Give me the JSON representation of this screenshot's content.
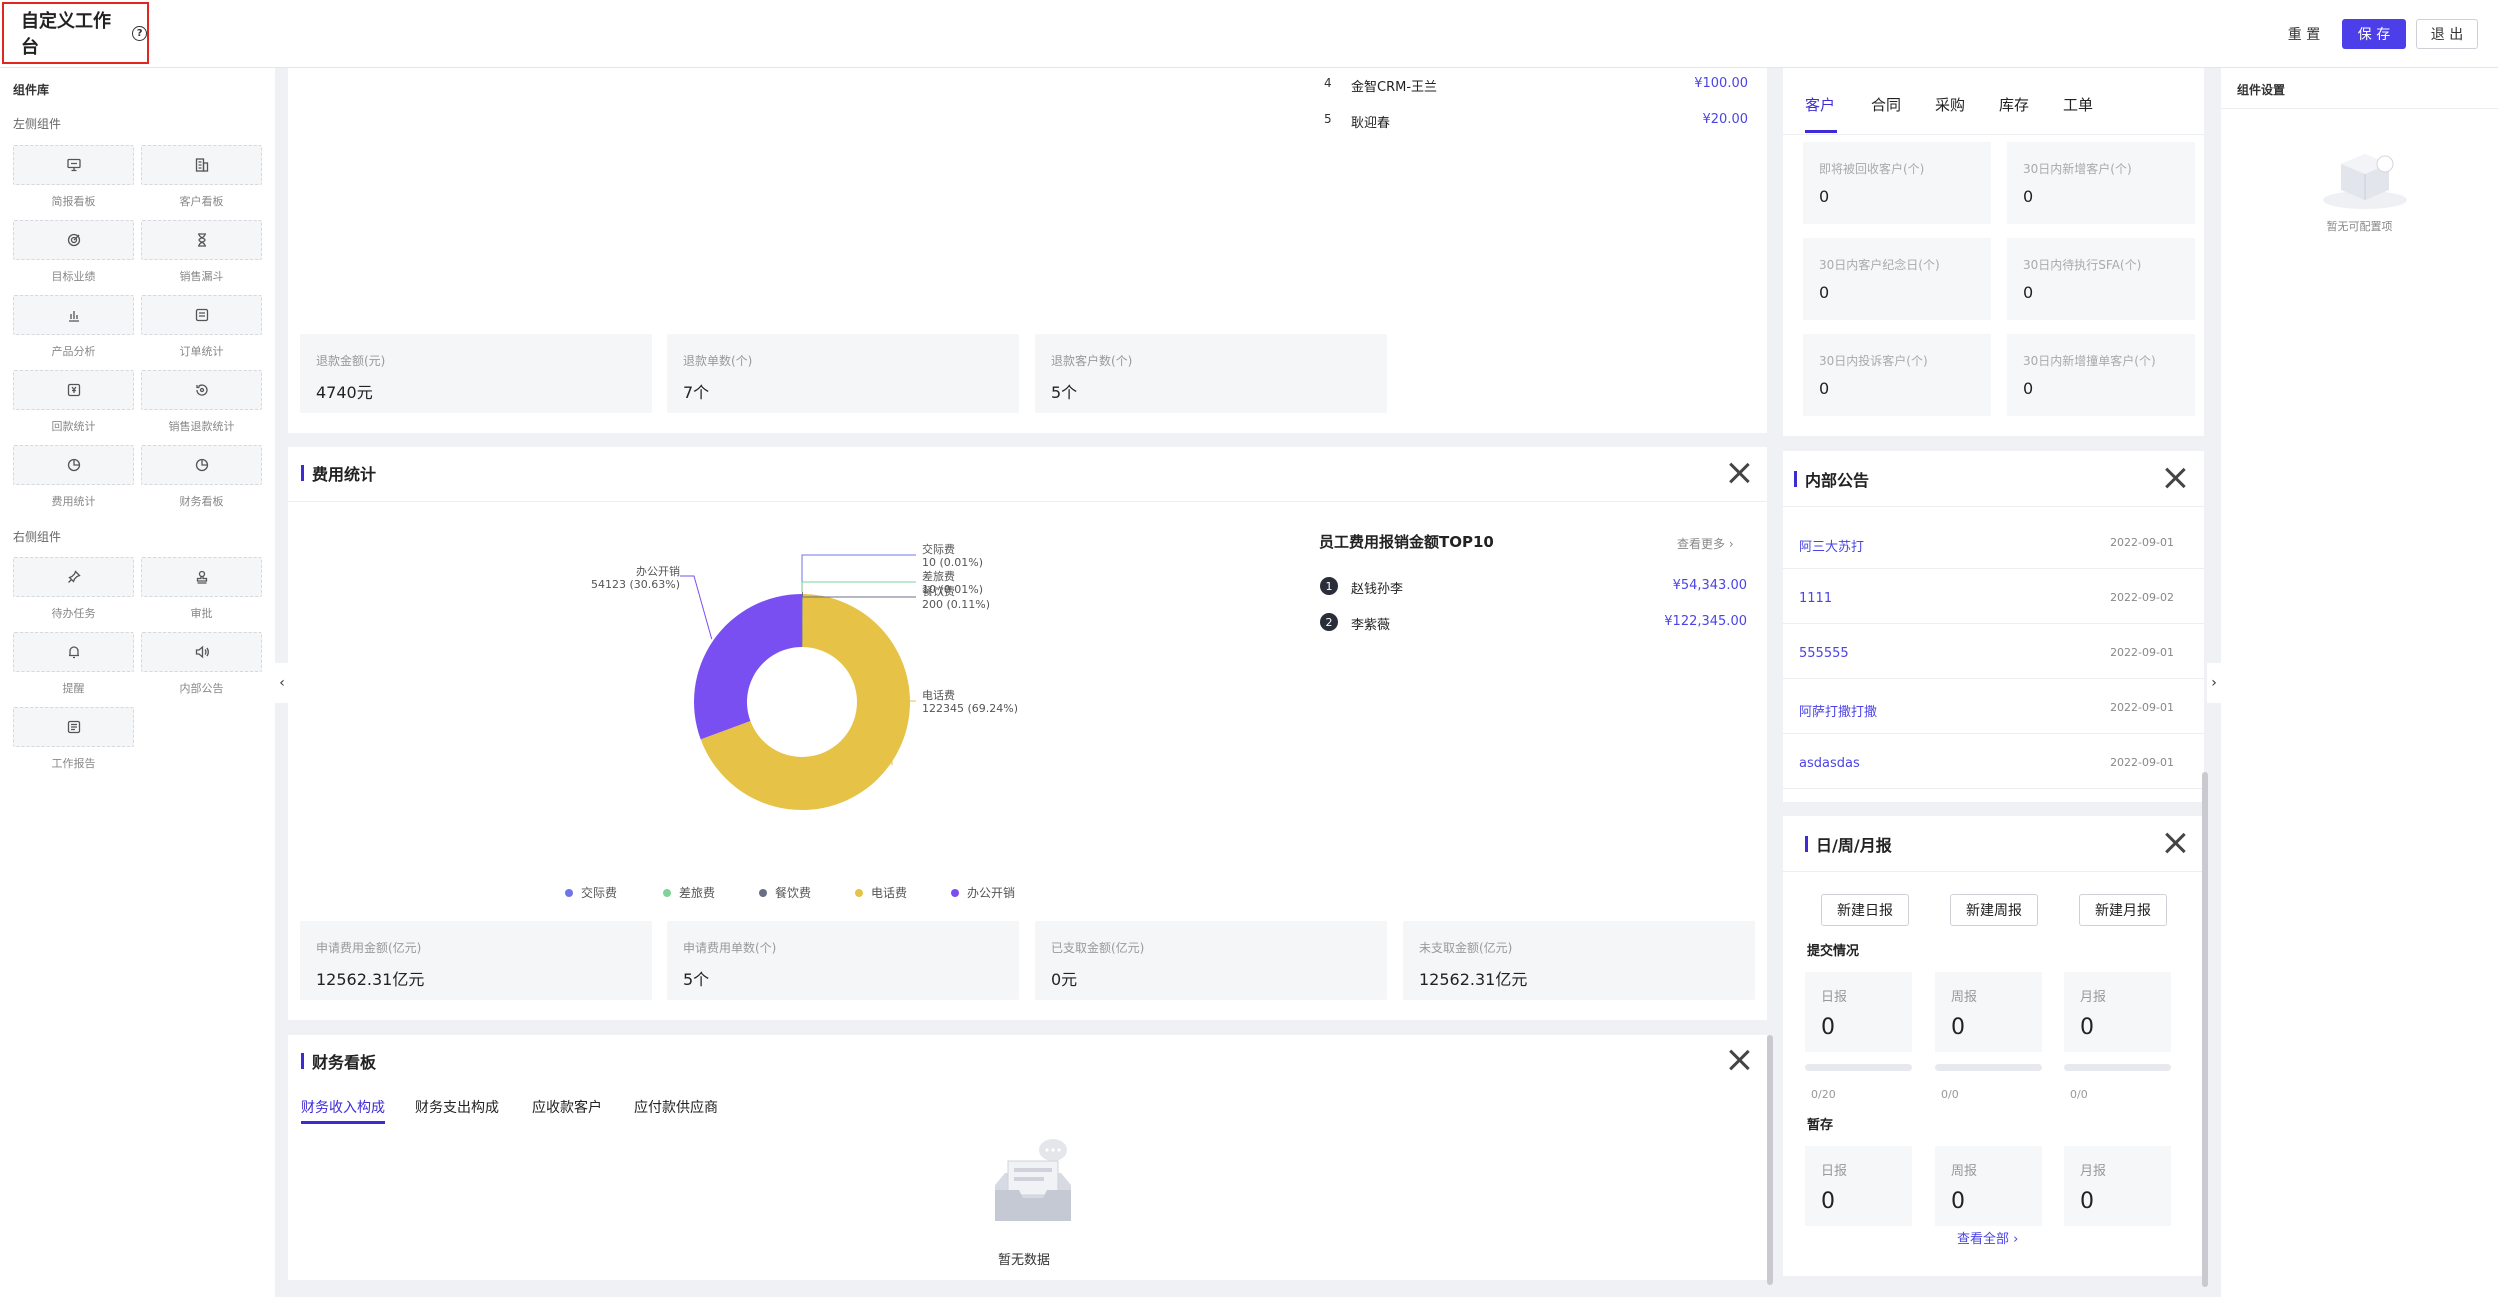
{
  "header": {
    "title": "自定义工作台",
    "help_glyph": "?",
    "reset": "重 置",
    "save": "保 存",
    "exit": "退 出"
  },
  "library": {
    "title": "组件库",
    "left_section": "左侧组件",
    "left_items": [
      {
        "label": "简报看板",
        "icon": "presentation-icon"
      },
      {
        "label": "客户看板",
        "icon": "building-icon"
      },
      {
        "label": "目标业绩",
        "icon": "target-icon"
      },
      {
        "label": "销售漏斗",
        "icon": "hourglass-icon"
      },
      {
        "label": "产品分析",
        "icon": "bar-chart-icon"
      },
      {
        "label": "订单统计",
        "icon": "list-doc-icon"
      },
      {
        "label": "回款统计",
        "icon": "money-icon"
      },
      {
        "label": "销售退款统计",
        "icon": "refund-icon"
      },
      {
        "label": "费用统计",
        "icon": "pie-icon"
      },
      {
        "label": "财务看板",
        "icon": "pie-icon"
      }
    ],
    "right_section": "右侧组件",
    "right_items": [
      {
        "label": "待办任务",
        "icon": "pin-icon"
      },
      {
        "label": "审批",
        "icon": "stamp-icon"
      },
      {
        "label": "提醒",
        "icon": "bell-icon"
      },
      {
        "label": "内部公告",
        "icon": "speaker-icon"
      },
      {
        "label": "工作报告",
        "icon": "report-icon"
      }
    ]
  },
  "settings": {
    "title": "组件设置",
    "empty": "暂无可配置项"
  },
  "refund": {
    "rank": [
      {
        "no": "4",
        "name": "金智CRM-王兰",
        "value": "¥100.00"
      },
      {
        "no": "5",
        "name": "耿迎春",
        "value": "¥20.00"
      }
    ],
    "stats": [
      {
        "label": "退款金额(元)",
        "value": "4740元"
      },
      {
        "label": "退款单数(个)",
        "value": "7个"
      },
      {
        "label": "退款客户数(个)",
        "value": "5个"
      }
    ]
  },
  "expense": {
    "title": "费用统计",
    "chart_data": {
      "type": "pie",
      "title": "",
      "categories": [
        "交际费",
        "差旅费",
        "餐饮费",
        "电话费",
        "办公开销"
      ],
      "values": [
        10,
        10,
        200,
        122345,
        54123
      ],
      "percents": [
        "(0.01%)",
        "(0.01%)",
        "(0.11%)",
        "(69.24%)",
        "(30.63%)"
      ],
      "colors": [
        "#6f74e8",
        "#7ed39a",
        "#6b6f86",
        "#e6c247",
        "#7a4ff2"
      ],
      "legend_position": "bottom"
    },
    "top_title": "员工费用报销金额TOP10",
    "more": "查看更多",
    "top": [
      {
        "no": "1",
        "name": "赵钱孙李",
        "value": "¥54,343.00"
      },
      {
        "no": "2",
        "name": "李紫薇",
        "value": "¥122,345.00"
      }
    ],
    "stats": [
      {
        "label": "申请费用金额(亿元)",
        "value": "12562.31亿元"
      },
      {
        "label": "申请费用单数(个)",
        "value": "5个"
      },
      {
        "label": "已支取金额(亿元)",
        "value": "0元"
      },
      {
        "label": "未支取金额(亿元)",
        "value": "12562.31亿元"
      }
    ]
  },
  "finance": {
    "title": "财务看板",
    "tabs": [
      "财务收入构成",
      "财务支出构成",
      "应收款客户",
      "应付款供应商"
    ],
    "empty": "暂无数据"
  },
  "customer": {
    "tabs": [
      "客户",
      "合同",
      "采购",
      "库存",
      "工单"
    ],
    "stats": [
      {
        "label": "即将被回收客户(个)",
        "value": "0"
      },
      {
        "label": "30日内新增客户(个)",
        "value": "0"
      },
      {
        "label": "30日内客户纪念日(个)",
        "value": "0"
      },
      {
        "label": "30日内待执行SFA(个)",
        "value": "0"
      },
      {
        "label": "30日内投诉客户(个)",
        "value": "0"
      },
      {
        "label": "30日内新增撞单客户(个)",
        "value": "0"
      }
    ]
  },
  "announcement": {
    "title": "内部公告",
    "items": [
      {
        "name": "阿三大苏打",
        "date": "2022-09-01"
      },
      {
        "name": "1111",
        "date": "2022-09-02"
      },
      {
        "name": "555555",
        "date": "2022-09-01"
      },
      {
        "name": "阿萨打撒打撒",
        "date": "2022-09-01"
      },
      {
        "name": "asdasdas",
        "date": "2022-09-01"
      }
    ]
  },
  "reports": {
    "title": "日/周/月报",
    "buttons": [
      "新建日报",
      "新建周报",
      "新建月报"
    ],
    "submit_title": "提交情况",
    "submit": [
      {
        "label": "日报",
        "value": "0",
        "progress": "0/20",
        "fraction": 0
      },
      {
        "label": "周报",
        "value": "0",
        "progress": "0/0",
        "fraction": 0
      },
      {
        "label": "月报",
        "value": "0",
        "progress": "0/0",
        "fraction": 0
      }
    ],
    "draft_title": "暂存",
    "draft": [
      {
        "label": "日报",
        "value": "0"
      },
      {
        "label": "周报",
        "value": "0"
      },
      {
        "label": "月报",
        "value": "0"
      }
    ],
    "view_all": "查看全部"
  }
}
